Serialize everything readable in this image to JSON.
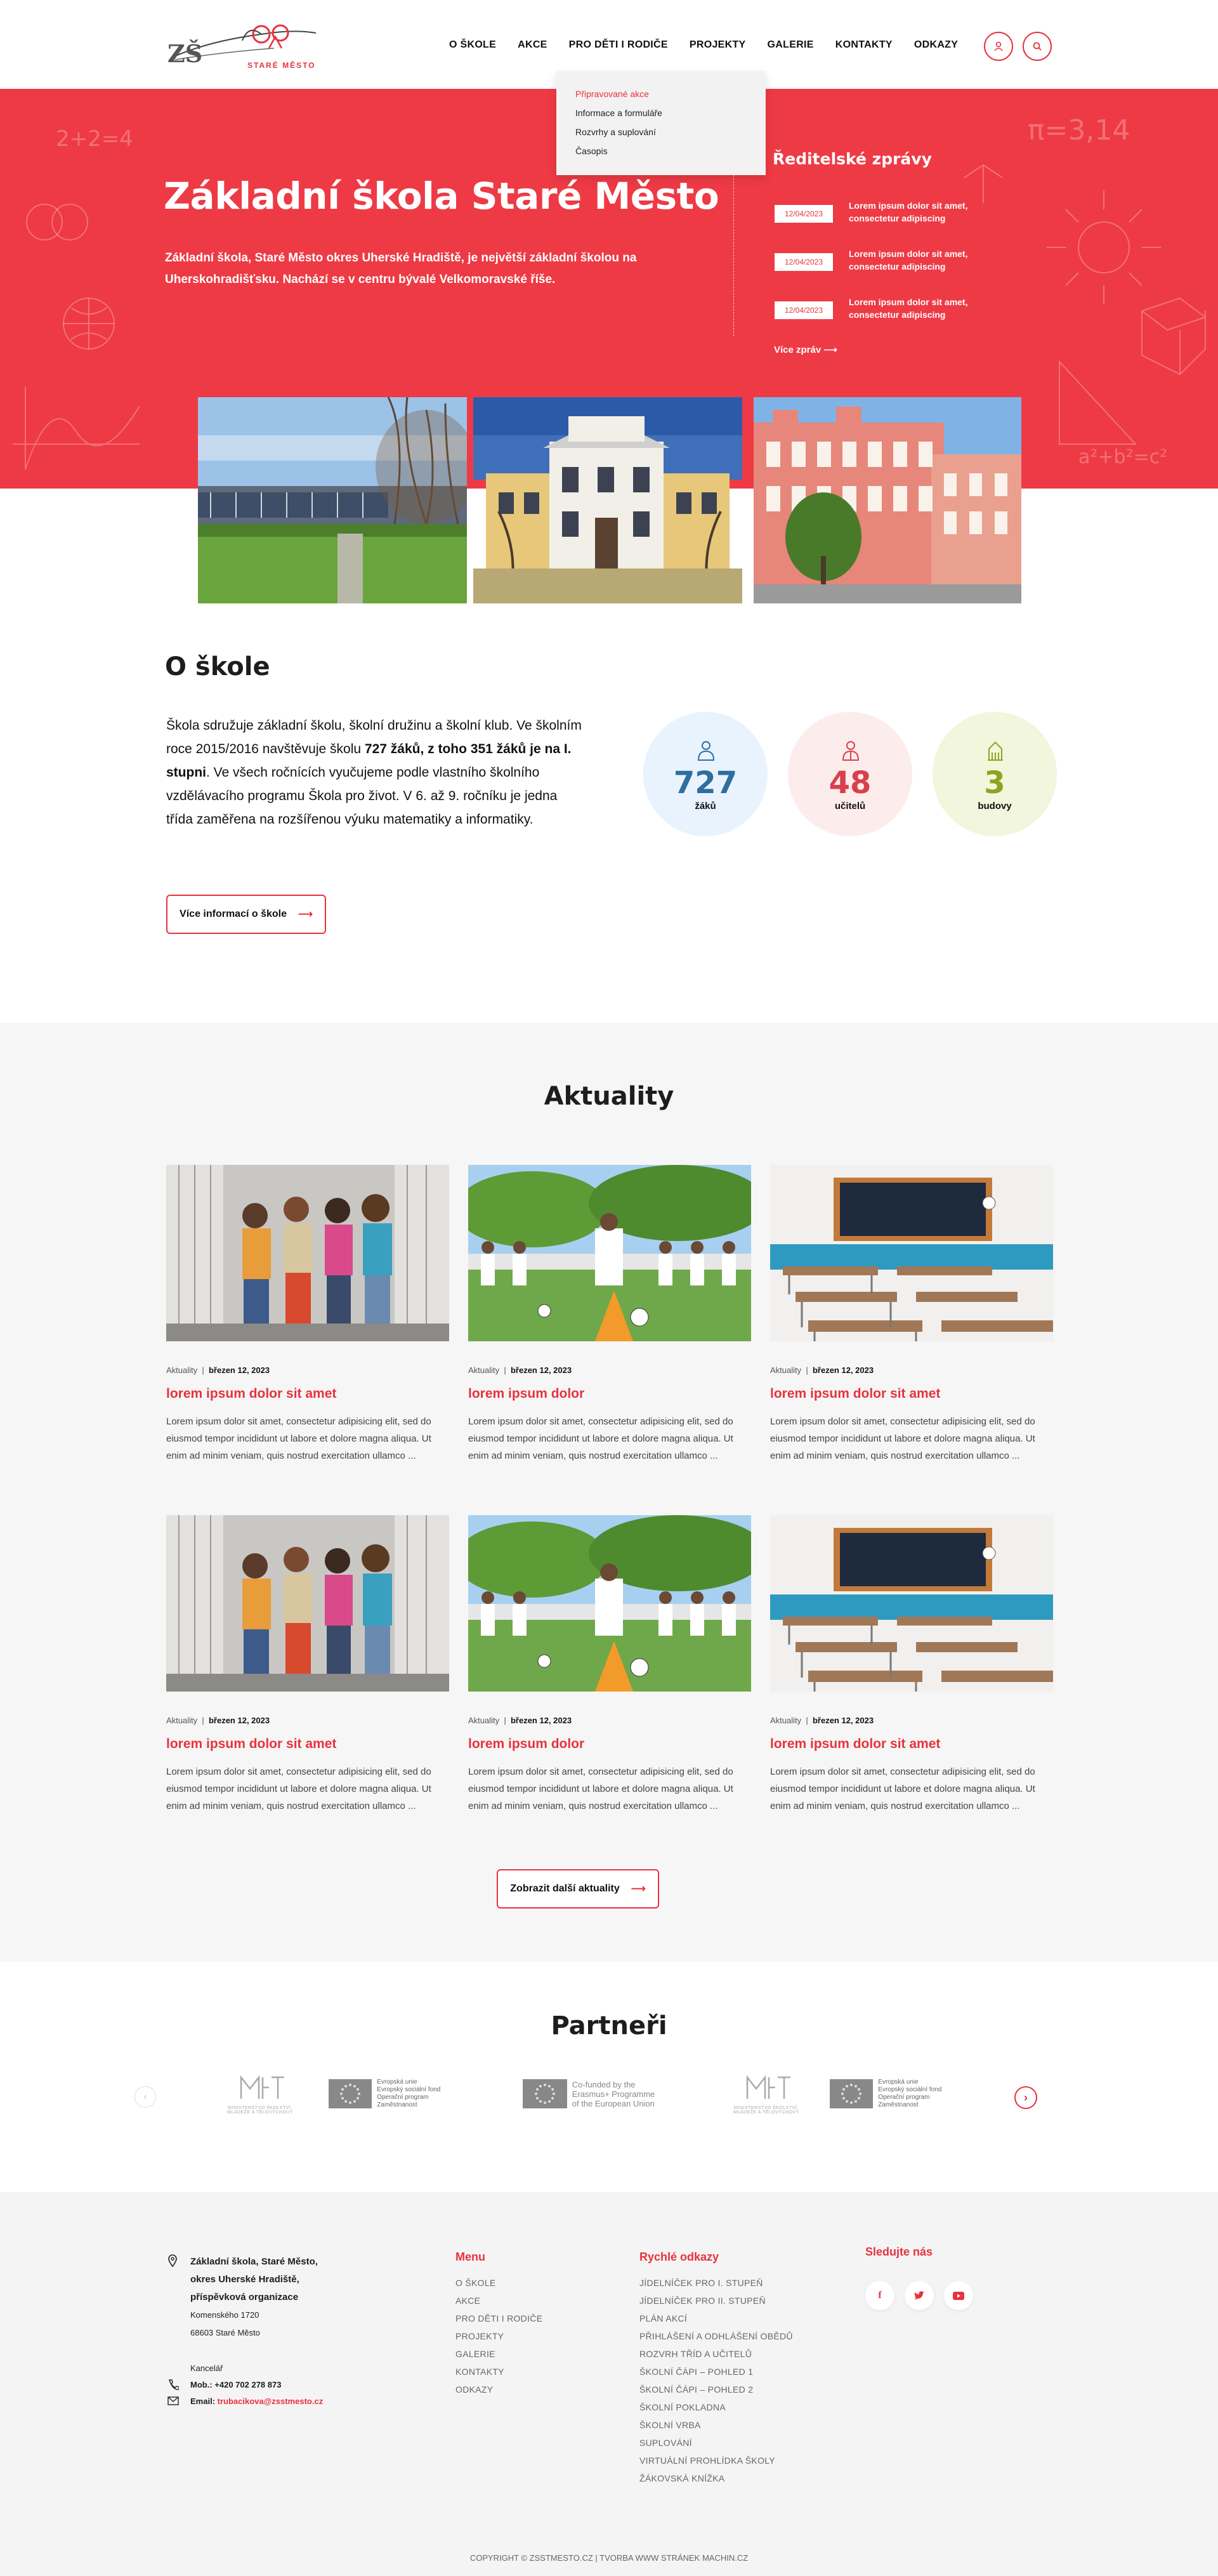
{
  "header": {
    "logo_text": "ZŠ",
    "logo_sub": "STARÉ MĚSTO",
    "nav": [
      "O ŠKOLE",
      "AKCE",
      "PRO DĚTI I RODIČE",
      "PROJEKTY",
      "GALERIE",
      "KONTAKTY",
      "ODKAZY"
    ],
    "dropdown": [
      "Připravované akce",
      "Informace a formuláře",
      "Rozvrhy a suplování",
      "Časopis"
    ]
  },
  "hero": {
    "title": "Základní škola Staré Město",
    "desc": "Základní škola, Staré Město okres Uherské Hradiště, je největší základní školou na Uherskohradišťsku. Nachází se v centru bývalé Velkomoravské říše.",
    "news_title": "Ředitelské zprávy",
    "news": [
      {
        "date": "12/04/2023",
        "text": "Lorem ipsum dolor sit amet, consectetur adipiscing"
      },
      {
        "date": "12/04/2023",
        "text": "Lorem ipsum dolor sit amet, consectetur adipiscing"
      },
      {
        "date": "12/04/2023",
        "text": "Lorem ipsum dolor sit amet, consectetur adipiscing"
      }
    ],
    "news_more": "Více zpráv"
  },
  "about": {
    "title": "O škole",
    "text_1": "Škola sdružuje základní školu, školní družinu a školní klub. Ve školním roce 2015/2016 navštěvuje školu ",
    "text_bold": "727 žáků, z toho 351 žáků je na I. stupni",
    "text_2": ". Ve všech ročnících vyučujeme podle vlastního školního vzdělávacího programu Škola pro život. V 6. až 9. ročníku je jedna třída zaměřena na rozšířenou výuku matematiky a informatiky.",
    "button": "Více informací o škole",
    "stats": [
      {
        "num": "727",
        "label": "žáků",
        "color": "#2f6e9e",
        "bg": "#e8f3fd"
      },
      {
        "num": "48",
        "label": "učitelů",
        "color": "#d9404b",
        "bg": "#fdecec"
      },
      {
        "num": "3",
        "label": "budovy",
        "color": "#8ea31f",
        "bg": "#f1f6dc"
      }
    ]
  },
  "news": {
    "title": "Aktuality",
    "cards": [
      {
        "cat": "Aktuality",
        "date": "březen 12, 2023",
        "title": "lorem ipsum dolor sit amet",
        "excerpt": "Lorem ipsum dolor sit amet, consectetur adipisicing elit, sed do eiusmod tempor incididunt ut labore et dolore magna aliqua. Ut enim ad minim veniam, quis nostrud exercitation ullamco ..."
      },
      {
        "cat": "Aktuality",
        "date": "březen 12, 2023",
        "title": "lorem ipsum dolor",
        "excerpt": "Lorem ipsum dolor sit amet, consectetur adipisicing elit, sed do eiusmod tempor incididunt ut labore et dolore magna aliqua. Ut enim ad minim veniam, quis nostrud exercitation ullamco ..."
      },
      {
        "cat": "Aktuality",
        "date": "březen 12, 2023",
        "title": "lorem ipsum dolor sit amet",
        "excerpt": "Lorem ipsum dolor sit amet, consectetur adipisicing elit, sed do eiusmod tempor incididunt ut labore et dolore magna aliqua. Ut enim ad minim veniam, quis nostrud exercitation ullamco ..."
      },
      {
        "cat": "Aktuality",
        "date": "březen 12, 2023",
        "title": "lorem ipsum dolor sit amet",
        "excerpt": "Lorem ipsum dolor sit amet, consectetur adipisicing elit, sed do eiusmod tempor incididunt ut labore et dolore magna aliqua. Ut enim ad minim veniam, quis nostrud exercitation ullamco ..."
      },
      {
        "cat": "Aktuality",
        "date": "březen 12, 2023",
        "title": "lorem ipsum dolor",
        "excerpt": "Lorem ipsum dolor sit amet, consectetur adipisicing elit, sed do eiusmod tempor incididunt ut labore et dolore magna aliqua. Ut enim ad minim veniam, quis nostrud exercitation ullamco ..."
      },
      {
        "cat": "Aktuality",
        "date": "březen 12, 2023",
        "title": "lorem ipsum dolor sit amet",
        "excerpt": "Lorem ipsum dolor sit amet, consectetur adipisicing elit, sed do eiusmod tempor incididunt ut labore et dolore magna aliqua. Ut enim ad minim veniam, quis nostrud exercitation ullamco ..."
      }
    ],
    "more_button": "Zobrazit další aktuality"
  },
  "partners": {
    "title": "Partneři",
    "eu_esf": [
      "Evropská unie",
      "Evropský sociální fond",
      "Operační program Zaměstnanost"
    ],
    "erasmus": [
      "Co-funded by the",
      "Erasmus+ Programme",
      "of the European Union"
    ],
    "msmt_sub": "MINISTERSTVO ŠKOLSTVÍ, MLÁDEŽE A TĚLOVÝCHOVY"
  },
  "footer": {
    "address": [
      "Základní škola, Staré Město,",
      "okres Uherské Hradiště,",
      "příspěvková organizace"
    ],
    "street": "Komenského 1720",
    "city": "68603 Staré Město",
    "office": "Kancelář",
    "phone_label": "Mob.:",
    "phone": "+420 702 278 873",
    "email_label": "Email:",
    "email": "trubacikova@zsstmesto.cz",
    "menu_title": "Menu",
    "menu": [
      "O ŠKOLE",
      "AKCE",
      "PRO DĚTI I RODIČE",
      "PROJEKTY",
      "GALERIE",
      "KONTAKTY",
      "ODKAZY"
    ],
    "quick_title": "Rychlé odkazy",
    "quick": [
      "JÍDELNÍČEK PRO I. STUPEŇ",
      "JÍDELNÍČEK PRO II. STUPEŇ",
      "PLÁN AKCÍ",
      "PŘIHLÁŠENÍ A ODHLÁŠENÍ OBĚDŮ",
      "ROZVRH TŘÍD A UČITELŮ",
      "ŠKOLNÍ ČÁPI – POHLED 1",
      "ŠKOLNÍ ČÁPI – POHLED 2",
      "ŠKOLNÍ POKLADNA",
      "ŠKOLNÍ VRBA",
      "SUPLOVÁNÍ",
      "VIRTUÁLNÍ PROHLÍDKA ŠKOLY",
      "ŽÁKOVSKÁ KNÍŽKA"
    ],
    "social_title": "Sledujte nás",
    "copyright": "COPYRIGHT © ZSSTMESTO.CZ | TVORBA WWW STRÁNEK MACHIN.CZ"
  },
  "colors": {
    "accent": "#e8323d",
    "hero": "#ee3a45",
    "section_bg": "#f6f6f6"
  }
}
